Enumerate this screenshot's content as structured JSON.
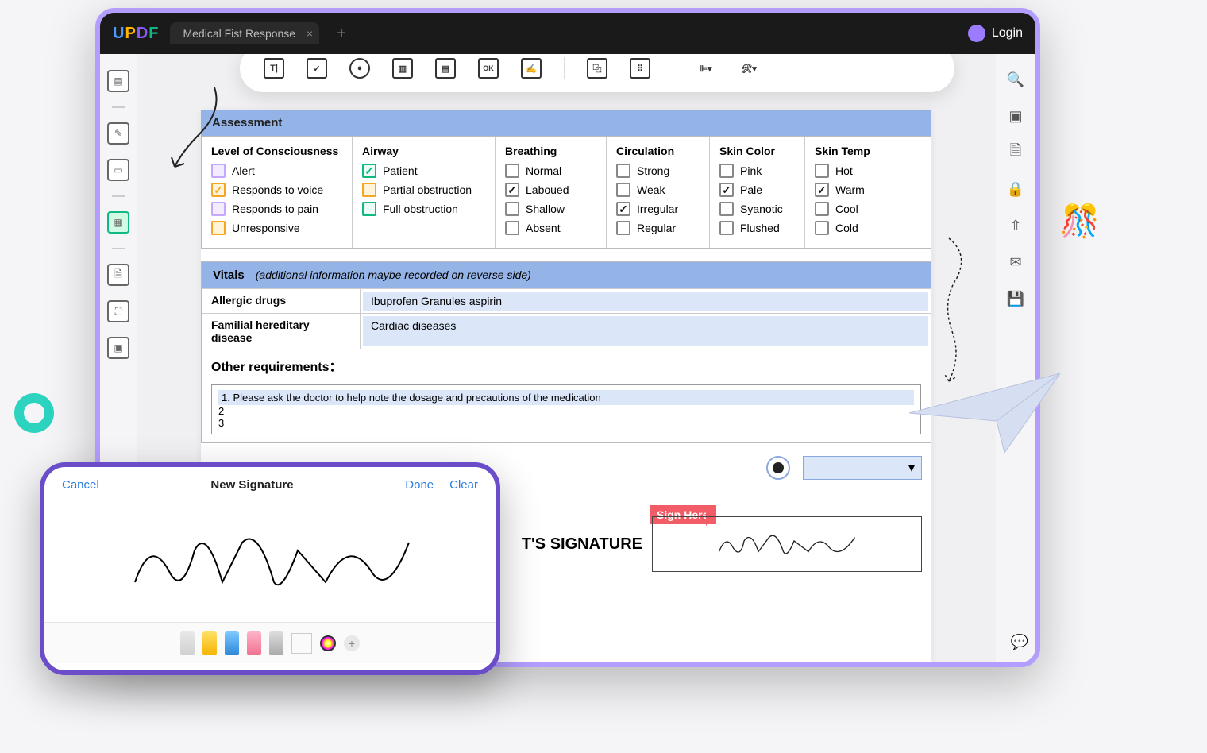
{
  "header": {
    "tab_title": "Medical Fist Response",
    "login_label": "Login"
  },
  "section": {
    "assessment": "Assessment",
    "vitals": "Vitals",
    "vitals_note": "(additional information maybe recorded on reverse side)"
  },
  "cols": {
    "loc": {
      "title": "Level of Consciousness",
      "items": [
        "Alert",
        "Responds to voice",
        "Responds to pain",
        "Unresponsive"
      ]
    },
    "airway": {
      "title": "Airway",
      "items": [
        "Patient",
        "Partial obstruction",
        "Full obstruction"
      ]
    },
    "breathing": {
      "title": "Breathing",
      "items": [
        "Normal",
        "Laboued",
        "Shallow",
        "Absent"
      ]
    },
    "circulation": {
      "title": "Circulation",
      "items": [
        "Strong",
        "Weak",
        "Irregular",
        "Regular"
      ]
    },
    "skincolor": {
      "title": "Skin Color",
      "items": [
        "Pink",
        "Pale",
        "Syanotic",
        "Flushed"
      ]
    },
    "skintemp": {
      "title": "Skin Temp",
      "items": [
        "Hot",
        "Warm",
        "Cool",
        "Cold"
      ]
    }
  },
  "vitals": {
    "allergic_label": "Allergic drugs",
    "allergic_value": "Ibuprofen Granules  aspirin",
    "familial_label": "Familial hereditary disease",
    "familial_value": "Cardiac diseases",
    "other_label": "Other requirements：",
    "other_lines": {
      "l1": "1. Please ask the doctor to help note the dosage and precautions of the medication",
      "l2": "2",
      "l3": "3"
    }
  },
  "signature": {
    "label": "T'S SIGNATURE",
    "sign_here": "Sign Here"
  },
  "phone": {
    "cancel": "Cancel",
    "title": "New Signature",
    "done": "Done",
    "clear": "Clear"
  }
}
